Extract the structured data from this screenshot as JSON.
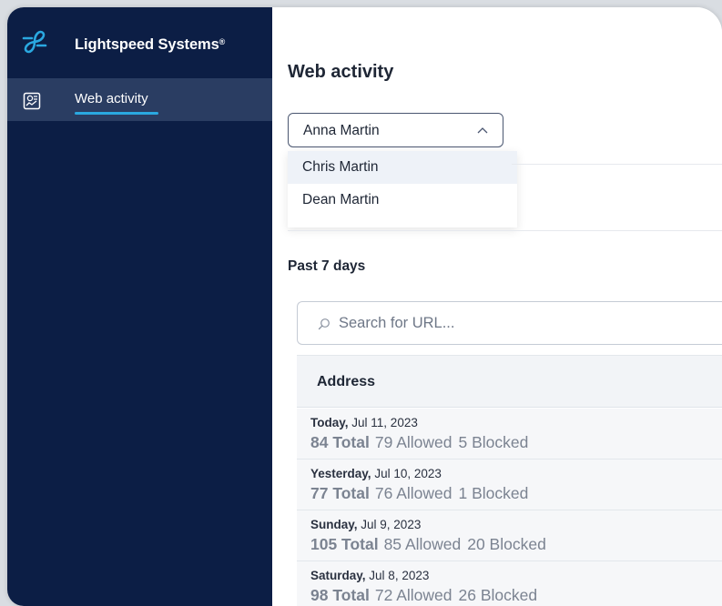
{
  "brand": {
    "name": "Lightspeed Systems",
    "mark": "®",
    "logo_icon": "lightspeed-logo-icon",
    "accent_color": "#2aa8e0"
  },
  "sidebar": {
    "background": "#0c1e45",
    "items": [
      {
        "label": "Web activity",
        "icon": "web-activity-icon",
        "active": true
      }
    ]
  },
  "main": {
    "title": "Web activity",
    "student_select": {
      "value": "Anna Martin",
      "expanded": true,
      "options": [
        "Chris Martin",
        "Dean Martin"
      ]
    },
    "period_label": "Past 7 days",
    "search": {
      "placeholder": "Search for URL...",
      "value": ""
    },
    "table": {
      "columns": [
        "Address"
      ],
      "rows": [
        {
          "day": "Today,",
          "date": "Jul 11, 2023",
          "total": "84 Total",
          "allowed": "79 Allowed",
          "blocked": "5 Blocked"
        },
        {
          "day": "Yesterday,",
          "date": "Jul 10, 2023",
          "total": "77 Total",
          "allowed": "76 Allowed",
          "blocked": "1 Blocked"
        },
        {
          "day": "Sunday,",
          "date": "Jul 9, 2023",
          "total": "105 Total",
          "allowed": "85 Allowed",
          "blocked": "20 Blocked"
        },
        {
          "day": "Saturday,",
          "date": "Jul 8, 2023",
          "total": "98 Total",
          "allowed": "72 Allowed",
          "blocked": "26 Blocked"
        }
      ]
    }
  }
}
